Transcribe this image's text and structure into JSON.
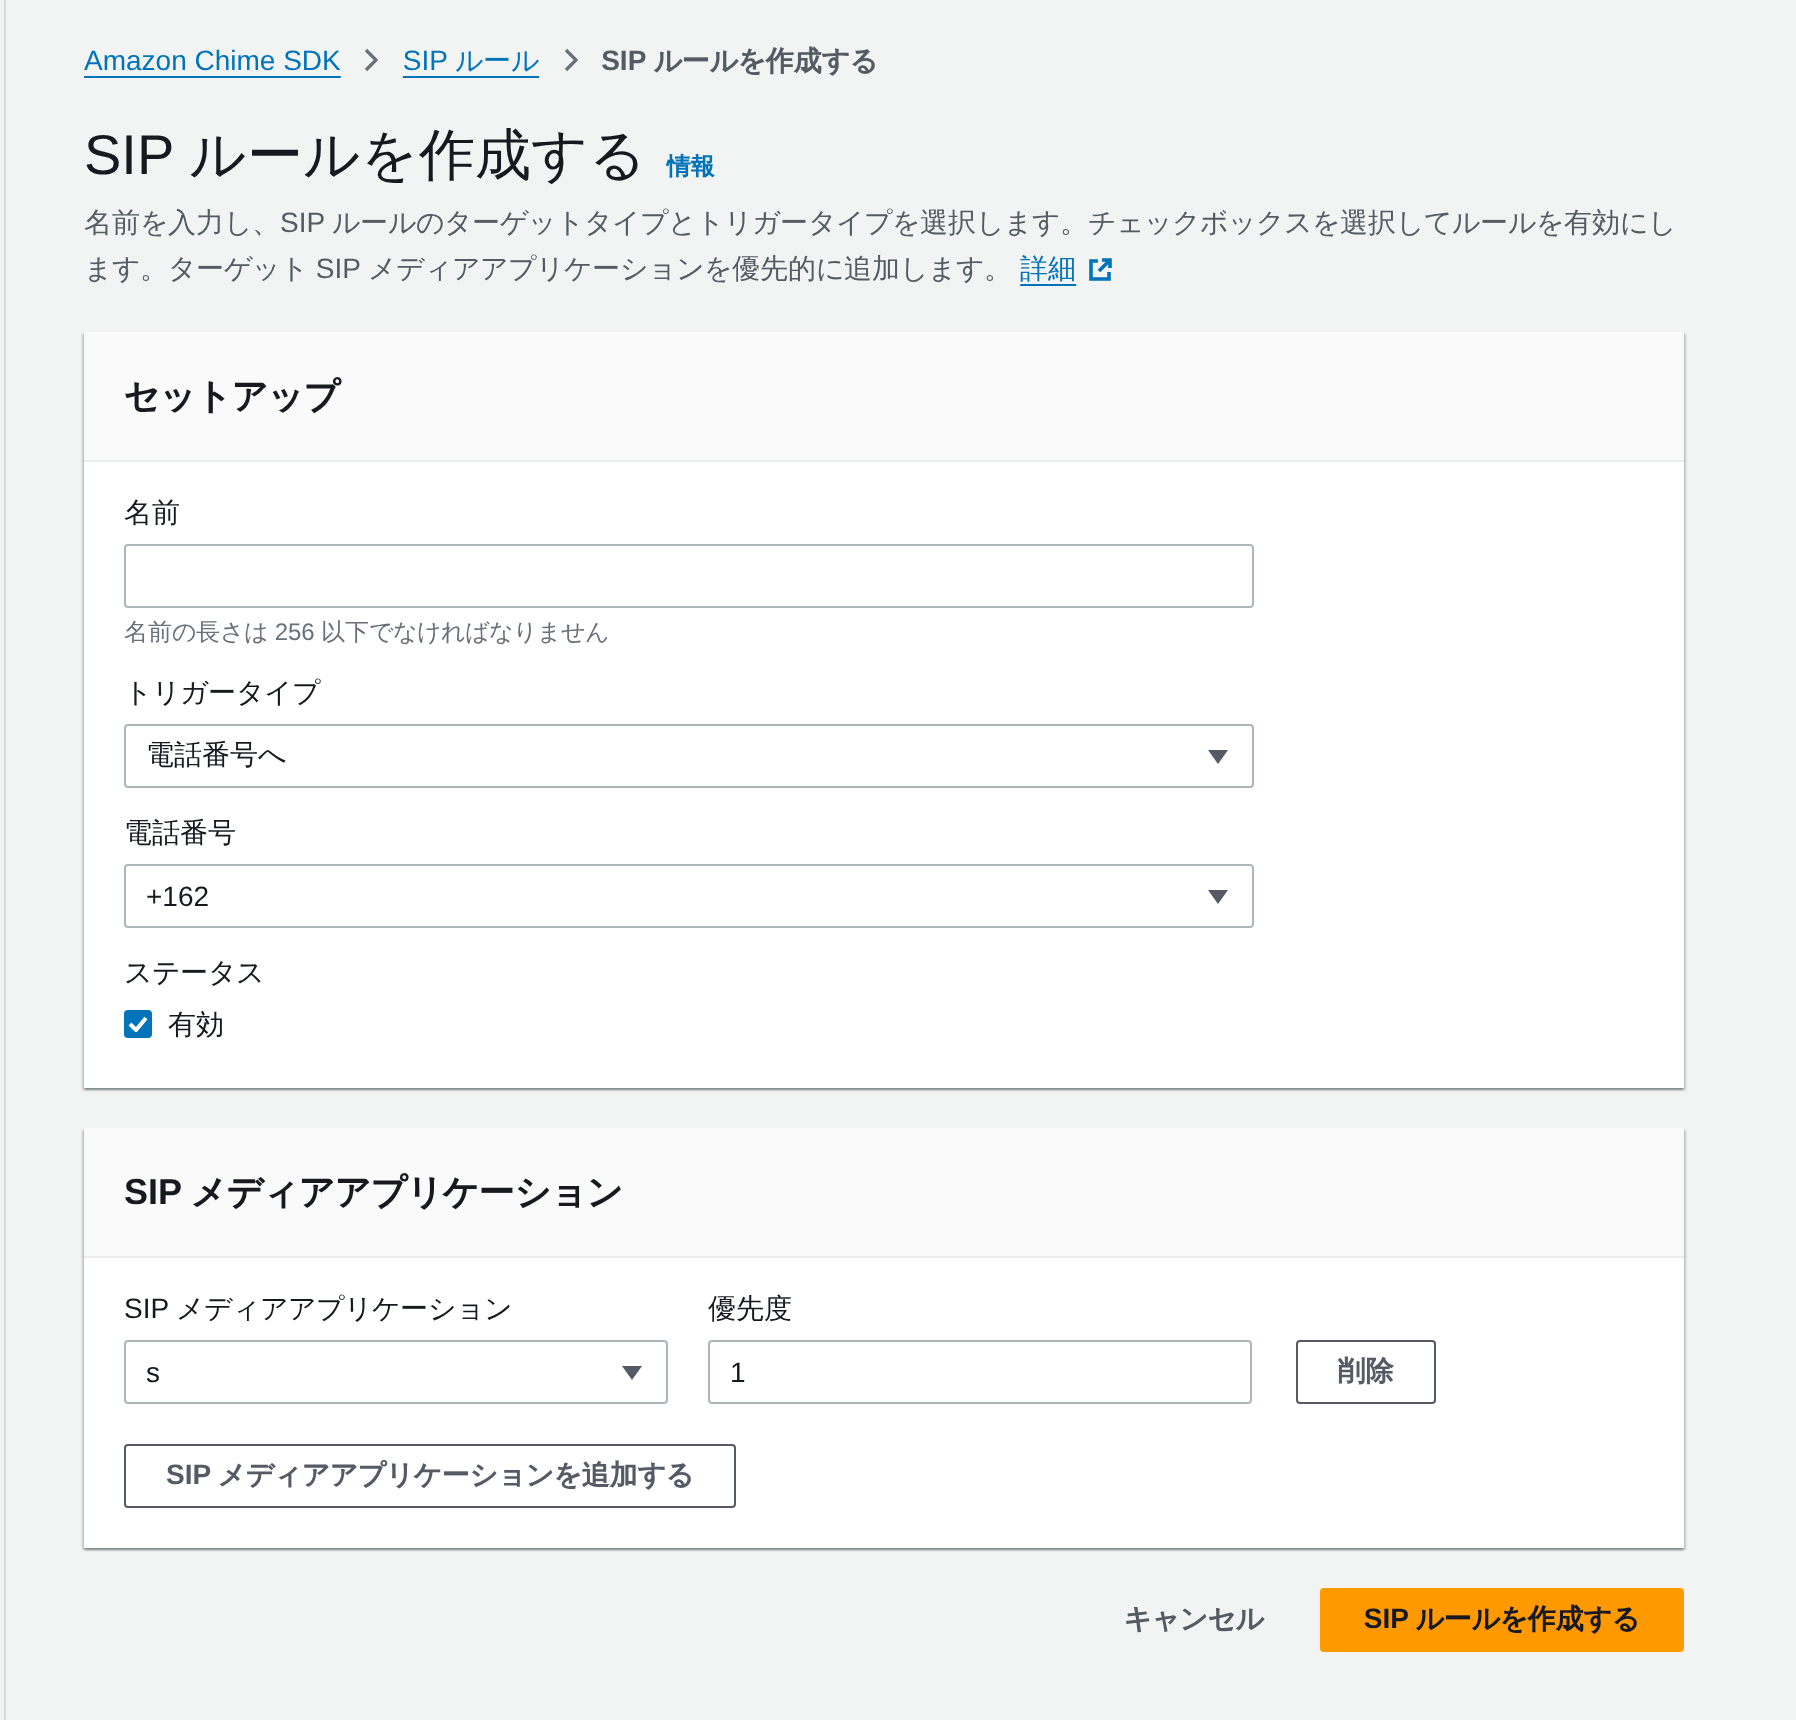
{
  "breadcrumbs": [
    {
      "label": "Amazon Chime SDK",
      "kind": "link"
    },
    {
      "label": "SIP ルール",
      "kind": "link"
    },
    {
      "label": "SIP ルールを作成する",
      "kind": "current"
    }
  ],
  "header": {
    "title": "SIP ルールを作成する",
    "info_link": "情報",
    "description": "名前を入力し、SIP ルールのターゲットタイプとトリガータイプを選択します。チェックボックスを選択してルールを有効にします。ターゲット SIP メディアアプリケーションを優先的に追加します。",
    "details_link": "詳細"
  },
  "setup": {
    "title": "セットアップ",
    "fields": [
      {
        "kind": "text",
        "label": "名前",
        "hint": "名前の長さは 256 以下でなければなりません"
      },
      {
        "kind": "select",
        "label": "トリガータイプ",
        "value": "電話番号へ"
      },
      {
        "kind": "select",
        "label": "電話番号",
        "value": "+162"
      },
      {
        "kind": "checkbox",
        "label": "ステータス",
        "option": "有効",
        "checked": true
      }
    ]
  },
  "media_applications": {
    "title": "SIP メディアアプリケーション",
    "columns": [
      "SIP メディアアプリケーション",
      "優先度"
    ],
    "rows": [
      {
        "application": "s",
        "priority": "1",
        "remove_button": "削除"
      }
    ],
    "add_button": "SIP メディアアプリケーションを追加する"
  },
  "actions": [
    {
      "label": "キャンセル",
      "kind": "link"
    },
    {
      "label": "SIP ルールを作成する",
      "kind": "primary"
    }
  ]
}
